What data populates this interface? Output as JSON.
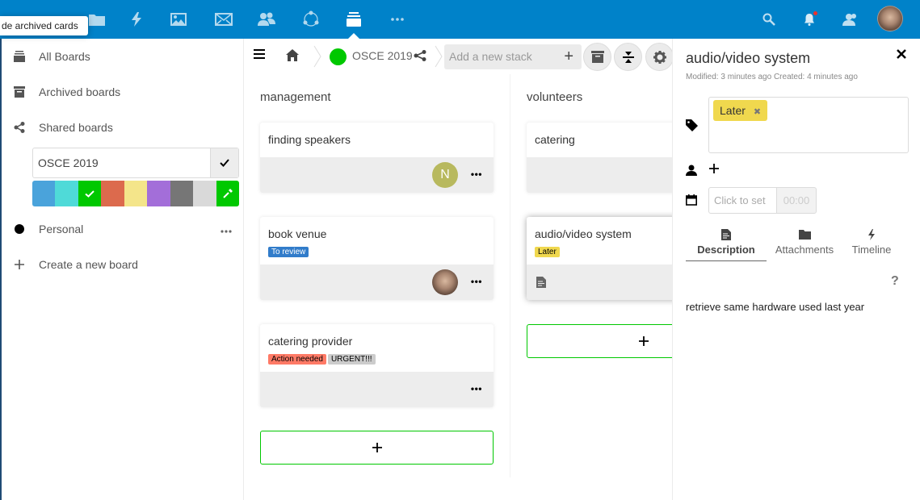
{
  "topbar": {
    "tooltip": "de archived cards",
    "apps": [
      {
        "name": "files",
        "icon": "folder-icon"
      },
      {
        "name": "activity",
        "icon": "lightning-icon"
      },
      {
        "name": "gallery",
        "icon": "image-icon"
      },
      {
        "name": "mail",
        "icon": "mail-icon"
      },
      {
        "name": "contacts",
        "icon": "contacts-icon"
      },
      {
        "name": "circles",
        "icon": "circles-icon"
      },
      {
        "name": "deck",
        "icon": "deck-icon",
        "active": true
      },
      {
        "name": "more",
        "icon": "more-icon"
      }
    ],
    "right": [
      "search-icon",
      "notifications-icon",
      "contacts-menu-icon",
      "user-avatar"
    ]
  },
  "leftnav": {
    "all_boards": "All Boards",
    "archived_boards": "Archived boards",
    "shared_boards": "Shared boards",
    "edit_board_value": "OSCE 2019",
    "colors": [
      "#4aa3db",
      "#4fdad8",
      "#00c800",
      "#dc6a4d",
      "#f4e58a",
      "#a36ed9",
      "#767676",
      "#d9d9d9",
      "#00c800"
    ],
    "selected_color": "#00c800",
    "personal": "Personal",
    "create_board": "Create a new board"
  },
  "controls": {
    "board_name": "OSCE 2019",
    "board_color": "#00c800",
    "add_stack_placeholder": "Add a new stack"
  },
  "stacks": [
    {
      "title": "management",
      "cards": [
        {
          "title": "finding speakers",
          "labels": [],
          "assignee": "N",
          "assignee_color": "#b8b95e"
        },
        {
          "title": "book venue",
          "labels": [
            {
              "text": "To review",
              "bg": "#317cca",
              "fg": "#fff"
            }
          ],
          "assignee_photo": true
        },
        {
          "title": "catering provider",
          "labels": [
            {
              "text": "Action needed",
              "bg": "#ff7a66",
              "fg": "#000"
            },
            {
              "text": "URGENT!!!",
              "bg": "#cccccc",
              "fg": "#000"
            }
          ]
        }
      ]
    },
    {
      "title": "volunteers",
      "cards": [
        {
          "title": "catering",
          "labels": []
        },
        {
          "title": "audio/video system",
          "labels": [
            {
              "text": "Later",
              "bg": "#f0d84e",
              "fg": "#000"
            }
          ],
          "has_description": true
        }
      ]
    }
  ],
  "details": {
    "title": "audio/video system",
    "meta": "Modified: 3 minutes ago Created: 4 minutes ago",
    "tag": "Later",
    "tag_color": "#f0d84e",
    "due_placeholder": "Click to set",
    "time_placeholder": "00:00",
    "tabs": [
      "Description",
      "Attachments",
      "Timeline"
    ],
    "active_tab": "Description",
    "help": "?",
    "description": "retrieve same hardware used last year"
  }
}
